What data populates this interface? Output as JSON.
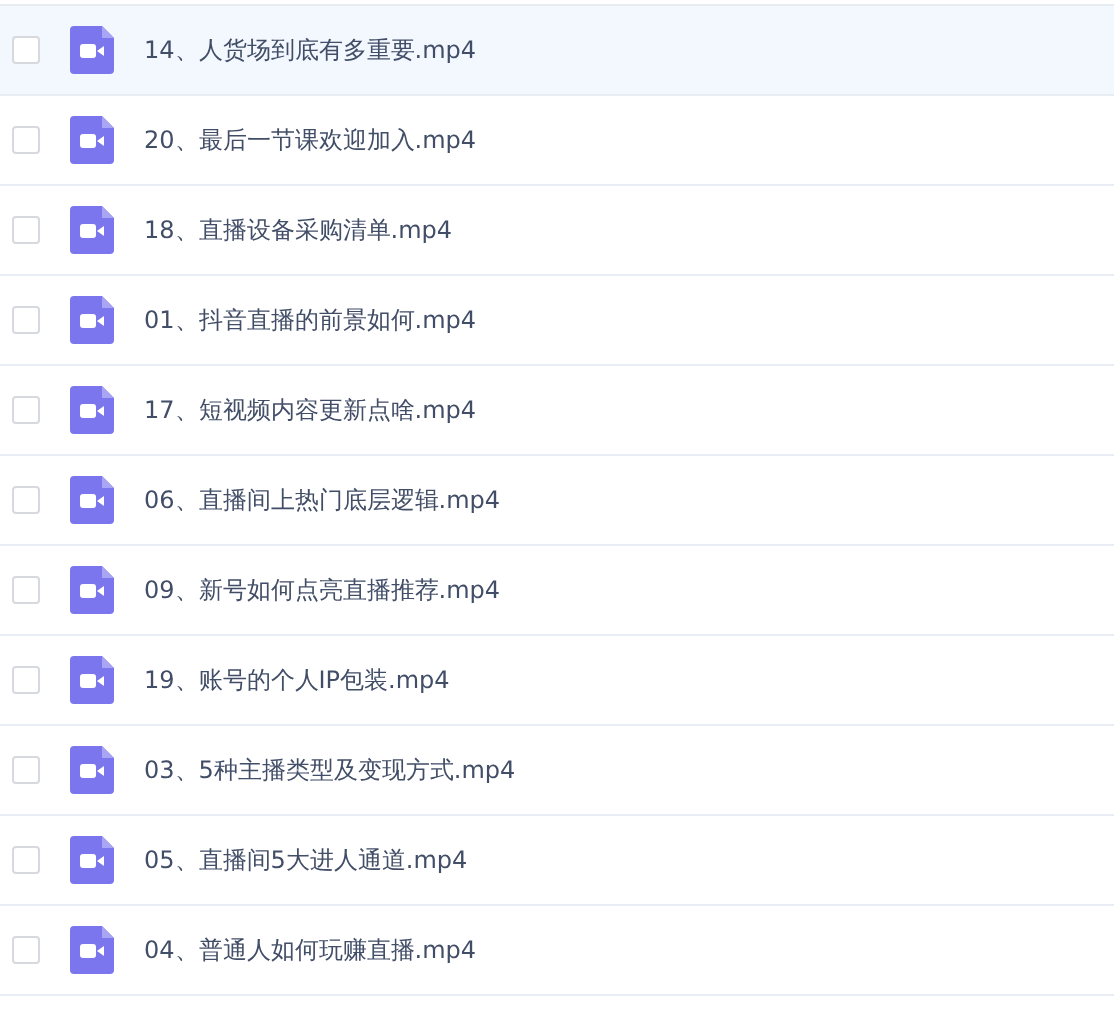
{
  "files": [
    {
      "name": "14、人货场到底有多重要.mp4",
      "checked": false,
      "selected": true
    },
    {
      "name": "20、最后一节课欢迎加入.mp4",
      "checked": false,
      "selected": false
    },
    {
      "name": "18、直播设备采购清单.mp4",
      "checked": false,
      "selected": false
    },
    {
      "name": "01、抖音直播的前景如何.mp4",
      "checked": false,
      "selected": false
    },
    {
      "name": "17、短视频内容更新点啥.mp4",
      "checked": false,
      "selected": false
    },
    {
      "name": "06、直播间上热门底层逻辑.mp4",
      "checked": false,
      "selected": false
    },
    {
      "name": "09、新号如何点亮直播推荐.mp4",
      "checked": false,
      "selected": false
    },
    {
      "name": "19、账号的个人IP包装.mp4",
      "checked": false,
      "selected": false
    },
    {
      "name": "03、5种主播类型及变现方式.mp4",
      "checked": false,
      "selected": false
    },
    {
      "name": "05、直播间5大进人通道.mp4",
      "checked": false,
      "selected": false
    },
    {
      "name": "04、普通人如何玩赚直播.mp4",
      "checked": false,
      "selected": false
    }
  ]
}
